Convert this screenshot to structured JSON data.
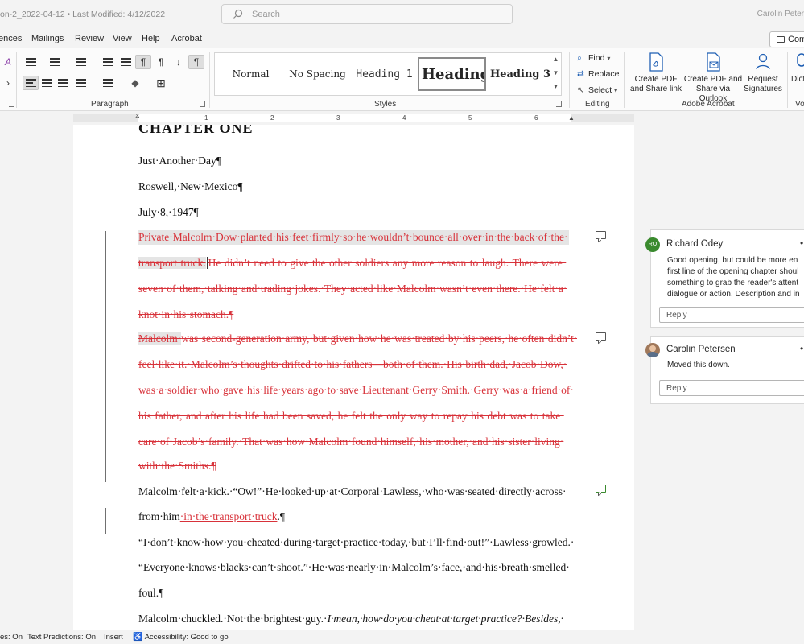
{
  "titlebar": {
    "doc_title": "on-2_2022-04-12  •  Last Modified: 4/12/2022",
    "search_placeholder": "Search",
    "user": "Carolin Peter"
  },
  "menu": {
    "tabs": [
      "ences",
      "Mailings",
      "Review",
      "View",
      "Help",
      "Acrobat"
    ],
    "comments_button": "Comm"
  },
  "ribbon": {
    "paragraph_label": "Paragraph",
    "styles_label": "Styles",
    "editing_label": "Editing",
    "acrobat_label": "Adobe Acrobat",
    "voice_label": "Vo",
    "styles": [
      "Normal",
      "No Spacing",
      "Heading 1",
      "Heading 2",
      "Heading 3"
    ],
    "editing": {
      "find": "Find",
      "replace": "Replace",
      "select": "Select"
    },
    "acrobat": {
      "create_pdf_l1": "Create PDF",
      "create_pdf_l2": "and Share link",
      "outlook_l1": "Create PDF and",
      "outlook_l2": "Share via Outlook",
      "request_l1": "Request",
      "request_l2": "Signatures",
      "dictate": "Dict"
    }
  },
  "ruler": {
    "numbers": [
      "1",
      "2",
      "3",
      "4",
      "5",
      "6"
    ]
  },
  "document": {
    "chapter": "CHAPTER ONE",
    "line1": "Just·Another·Day¶",
    "line2": "Roswell,·New·Mexico¶",
    "line3": "July·8,·1947¶",
    "p1": [
      "Private·Malcolm·Dow·planted·his·feet·firmly·so·he·wouldn’t·bounce·all·over·in·the·back·of·the·",
      "transport·truck.",
      "He·didn’t·need·to·give·the·other·soldiers·any·more·reason·to·laugh.·There·were·",
      "seven·of·them,·talking·and·trading·jokes.·They·acted·like·Malcolm·wasn’t·even·there.·He·felt·a·",
      "knot·in·his·stomach.¶"
    ],
    "p2": [
      "Malcolm·",
      "was·second-generation·army,·but·given·how·he·was·treated·by·his·peers,·he·often·didn’t·",
      "feel·like·it.·Malcolm’s·thoughts·drifted·to·his·fathers—both·of·them.·His·birth·dad,·Jacob·Dow,·",
      "was·a·soldier·who·gave·his·life·years·ago·to·save·Lieutenant·Gerry·Smith.·Gerry·was·a·friend·of·",
      "his·father,·and·after·his·life·had·been·saved,·he·felt·the·only·way·to·repay·his·debt·was·to·take·",
      "care·of·Jacob’s·family.·That·was·how·Malcolm·found·himself,·his·mother,·and·his·sister·living·",
      "with·the·Smiths.¶"
    ],
    "p3": [
      "Malcolm·felt·a·kick.·“Ow!”·He·looked·up·at·Corporal·Lawless,·who·was·seated·directly·across·",
      "from·him",
      "·in·the·transport·truck",
      ".¶"
    ],
    "p4": [
      "“I·don’t·know·how·you·cheated·during·target·practice·today,·but·I’ll·find·out!”·Lawless·growled.·",
      "“Everyone·knows·blacks·can’t·shoot.”·He·was·nearly·in·Malcolm’s·face,·and·his·breath·smelled·",
      "foul.¶"
    ],
    "p5": {
      "normal": "Malcolm·chuckled.·Not·the·brightest·guy.·",
      "italic": "I·mean,·how·do·you·cheat·at·target·practice?·Besides,·"
    }
  },
  "comments": [
    {
      "initials": "RO",
      "avatar_color": "#3a8a2e",
      "name": "Richard Odey",
      "lines": [
        "Good opening, but could be more en",
        "first line of the opening chapter shoul",
        "something to grab the reader's attent",
        "dialogue or action. Description and in"
      ],
      "reply": "Reply"
    },
    {
      "initials": "",
      "avatar_color": "#a0785a",
      "name": "Carolin Petersen",
      "lines": [
        "Moved this down."
      ],
      "reply": "Reply"
    }
  ],
  "status": {
    "item1": "es: On",
    "item2": "Text Predictions: On",
    "item3": "Insert",
    "item4": "Accessibility: Good to go"
  },
  "colors": {
    "tracked_change": "#d8323a",
    "accent": "#1f5fb4"
  }
}
